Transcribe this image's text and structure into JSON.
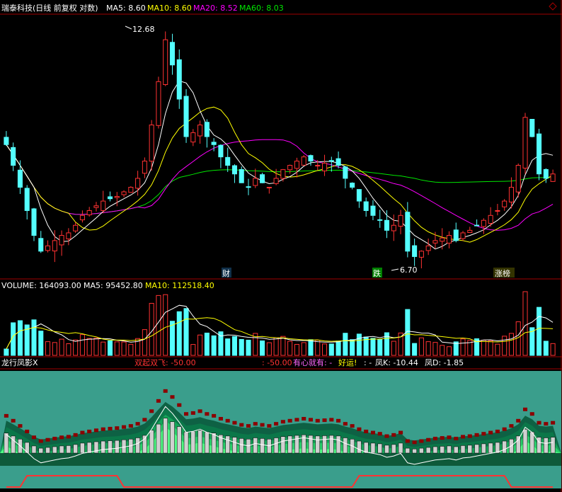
{
  "header": {
    "title": "瑞泰科技(日线 前复权 对数)",
    "ma5_label": "MA5: 8.60",
    "ma10_label": "MA10: 8.60",
    "ma20_label": "MA20: 8.52",
    "ma60_label": "MA60: 8.03",
    "corner_icon": "diamond-icon"
  },
  "price_panel": {
    "high_label": "12.68",
    "low_label": "6.70",
    "markers": [
      "财",
      "跌",
      "涨榜"
    ]
  },
  "volume_panel": {
    "volume_label": "VOLUME: 164093.00",
    "ma5_label": "MA5: 95452.80",
    "ma10_label": "MA10: 112518.40"
  },
  "indicator_panel": {
    "name": "龙行凤影X",
    "label1": "双起双飞: -50.00",
    "label2": ": -50.00",
    "label3": "有心就有: -",
    "label4": "好运!",
    "label5": ": -",
    "label6": "凤K: -10.44",
    "label7": "凤D: -1.85"
  },
  "colors": {
    "up": "#ff3232",
    "down": "#54ffff",
    "ma5": "#ffffff",
    "ma10": "#ffff00",
    "ma20": "#ff00ff",
    "ma60": "#00e600",
    "divider": "#a00000"
  },
  "chart_data": {
    "type": "candlestick",
    "scale": "log",
    "price_range": [
      6.7,
      12.68
    ],
    "last_close": 8.6,
    "close_series": [
      9.3,
      8.8,
      8.3,
      7.8,
      7.3,
      7.0,
      7.1,
      7.2,
      7.3,
      7.35,
      7.5,
      7.7,
      7.8,
      7.9,
      8.0,
      8.05,
      8.1,
      8.2,
      8.3,
      8.5,
      8.9,
      9.8,
      11.0,
      12.3,
      11.5,
      10.5,
      9.5,
      9.6,
      9.8,
      9.5,
      9.3,
      9.0,
      8.8,
      8.6,
      8.4,
      8.3,
      8.5,
      8.4,
      8.3,
      8.5,
      8.7,
      8.8,
      8.9,
      9.0,
      8.9,
      8.8,
      8.85,
      8.9,
      8.8,
      8.5,
      8.3,
      8.0,
      7.8,
      7.7,
      7.6,
      7.4,
      7.5,
      7.7,
      7.0,
      6.9,
      7.0,
      7.1,
      7.2,
      7.25,
      7.3,
      7.2,
      7.35,
      7.4,
      7.5,
      7.6,
      7.7,
      7.8,
      8.0,
      8.3,
      8.8,
      10.0,
      9.5,
      8.6,
      8.5,
      8.6
    ],
    "ma5_value": 8.6,
    "ma10_value": 8.6,
    "ma20_value": 8.52,
    "ma60_value": 8.03,
    "volume_last": 164093.0,
    "volume_ma5": 95452.8,
    "volume_ma10": 112518.4
  }
}
